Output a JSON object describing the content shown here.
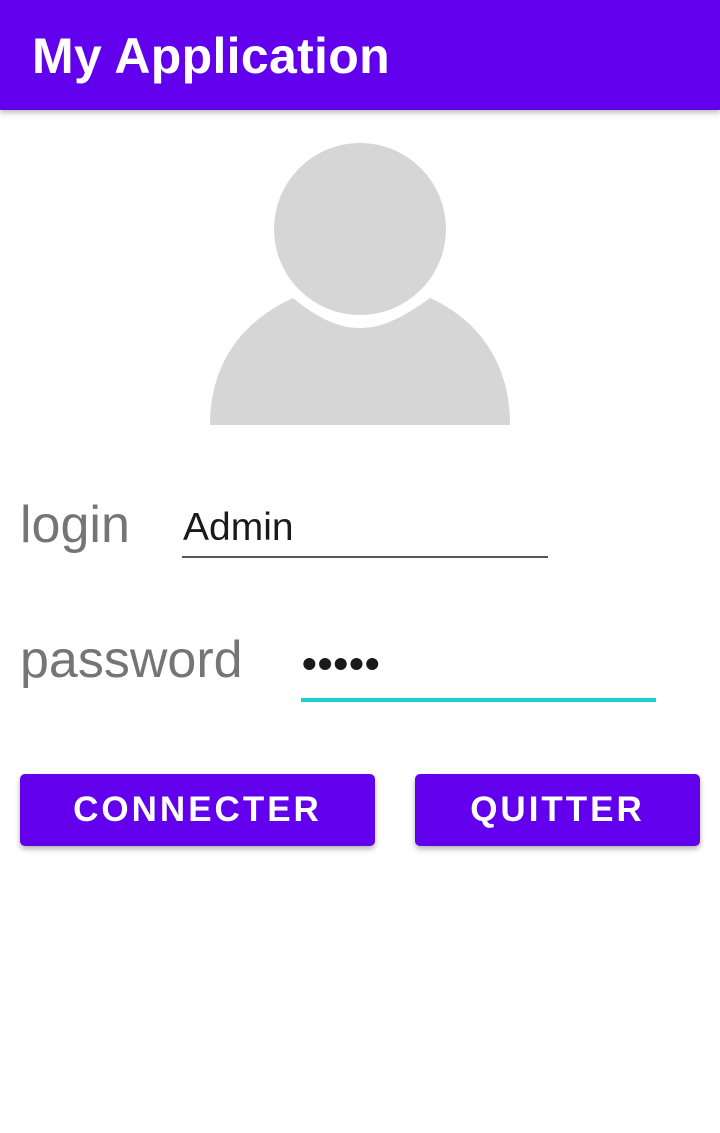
{
  "app_bar": {
    "title": "My Application",
    "color": "#6200ee"
  },
  "avatar": {
    "icon": "user-silhouette-icon",
    "color": "#d6d6d6"
  },
  "form": {
    "login_label": "login",
    "login_value": "Admin",
    "password_label": "password",
    "password_value": "•••••",
    "focused_field": "password",
    "focus_color": "#1ccfcf"
  },
  "buttons": {
    "connect_label": "CONNECTER",
    "quit_label": "QUITTER"
  }
}
